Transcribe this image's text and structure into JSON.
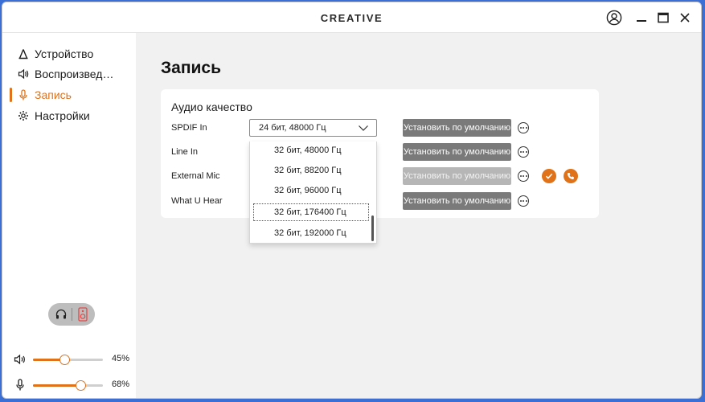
{
  "app": {
    "brand": "CREATIVE",
    "window_controls": [
      "account",
      "minimize",
      "maximize",
      "close"
    ]
  },
  "sidebar": {
    "items": [
      {
        "label": "Устройство",
        "icon": "device-icon",
        "active": false
      },
      {
        "label": "Воспроизвед…",
        "icon": "speaker-icon",
        "active": false
      },
      {
        "label": "Запись",
        "icon": "microphone-icon",
        "active": true
      },
      {
        "label": "Настройки",
        "icon": "gear-icon",
        "active": false
      }
    ],
    "output_toggle": {
      "options": [
        "headphones-icon",
        "speaker-icon"
      ],
      "selected": "speaker-icon"
    },
    "volume": {
      "value": "45%",
      "level": 0.45
    },
    "mic": {
      "value": "68%",
      "level": 0.68
    }
  },
  "main": {
    "title": "Запись",
    "card": {
      "title": "Аудио качество",
      "default_label": "Установить по умолчанию",
      "rows": [
        {
          "label": "SPDIF In",
          "value": "24 бит, 48000 Гц",
          "default_disabled": false,
          "show_actions": false
        },
        {
          "label": "Line In",
          "value": "",
          "default_disabled": false,
          "show_actions": false
        },
        {
          "label": "External Mic",
          "value": "",
          "default_disabled": true,
          "show_actions": true
        },
        {
          "label": "What U Hear",
          "value": "",
          "default_disabled": false,
          "show_actions": false
        }
      ]
    },
    "dropdown": {
      "options": [
        "32 бит, 48000 Гц",
        "32 бит, 88200 Гц",
        "32 бит, 96000 Гц",
        "32 бит, 176400 Гц",
        "32 бит, 192000 Гц"
      ],
      "focused_index": 3
    }
  },
  "colors": {
    "accent": "#e0731a",
    "button_gray": "#7a7a7a",
    "button_disabled": "#b6b6b6",
    "desktop": "#3b6fd6"
  }
}
